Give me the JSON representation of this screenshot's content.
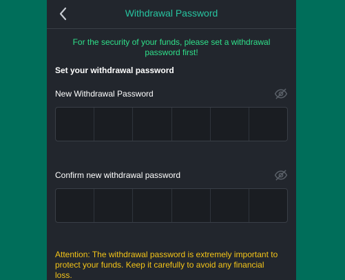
{
  "header": {
    "title": "Withdrawal Password",
    "back_icon": "chevron-left-icon"
  },
  "notice": "For the security of your funds, please set a withdrawal password first!",
  "section_title": "Set your withdrawal password",
  "fields": [
    {
      "label": "New Withdrawal Password",
      "icon": "eye-off-icon",
      "cells": 6
    },
    {
      "label": "Confirm new withdrawal password",
      "icon": "eye-off-icon",
      "cells": 6
    }
  ],
  "attention": "Attention: The withdrawal password is extremely important to protect your funds. Keep it carefully to avoid any financial loss.",
  "colors": {
    "background": "#006e5a",
    "panel": "#22262d",
    "accent": "#27c5a1",
    "notice": "#2fe08a",
    "warning": "#f5c518"
  }
}
